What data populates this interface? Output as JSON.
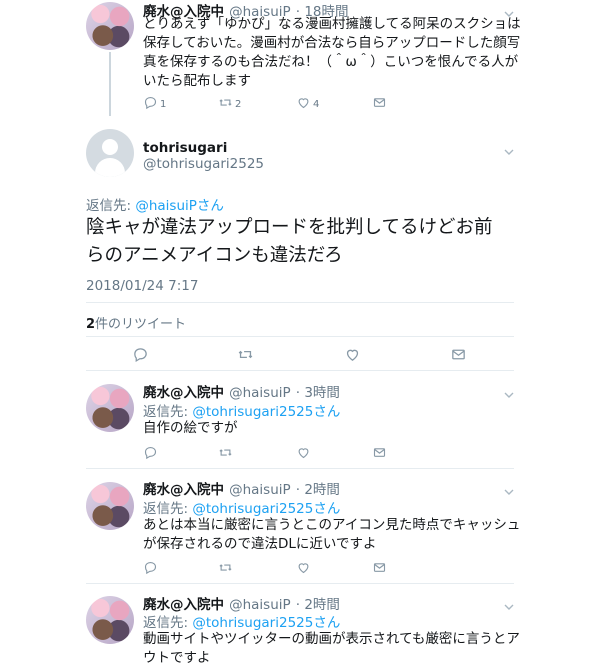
{
  "tweet1": {
    "name": "廃水@入院中",
    "handle": "@haisuiP",
    "time": "· 18時間",
    "text_lines": [
      "とりあえず「ゆかぴ」なる漫画村擁護してる阿呆のスクショは",
      "保存しておいた。漫画村が合法なら自らアップロードした顔写",
      "真を保存するのも合法だね！（＾ω＾）こいつを恨んでる人が",
      "いたら配布します"
    ],
    "reply_count": "1",
    "retweet_count": "2",
    "like_count": "4"
  },
  "main": {
    "name": "tohrisugari",
    "handle": "@tohrisugari2525",
    "reply_to_prefix": "返信先: ",
    "reply_to_handle": "@haisuiPさん",
    "text_lines": [
      "陰キャが違法アップロードを批判してるけどお前",
      "らのアニメアイコンも違法だろ"
    ],
    "timestamp": "2018/01/24 7:17",
    "retweet_num": "2",
    "retweet_label": "件のリツイート"
  },
  "replies": [
    {
      "name": "廃水@入院中",
      "handle": "@haisuiP",
      "time": "· 3時間",
      "reply_to_prefix": "返信先: ",
      "reply_to_handle": "@tohrisugari2525さん",
      "text_lines": [
        "自作の絵ですが"
      ]
    },
    {
      "name": "廃水@入院中",
      "handle": "@haisuiP",
      "time": "· 2時間",
      "reply_to_prefix": "返信先: ",
      "reply_to_handle": "@tohrisugari2525さん",
      "text_lines": [
        "あとは本当に厳密に言うとこのアイコン見た時点でキャッシュ",
        "が保存されるので違法DLに近いですよ"
      ]
    },
    {
      "name": "廃水@入院中",
      "handle": "@haisuiP",
      "time": "· 2時間",
      "reply_to_prefix": "返信先: ",
      "reply_to_handle": "@tohrisugari2525さん",
      "text_lines": [
        "動画サイトやツイッターの動画が表示されても厳密に言うとア",
        "ウトですよ"
      ]
    }
  ],
  "icons": {
    "reply": "reply-icon",
    "retweet": "retweet-icon",
    "like": "heart-icon",
    "dm": "mail-icon",
    "more": "chevron-down-icon",
    "avatar_default": "default-avatar-icon"
  },
  "colors": {
    "accent": "#1da1f2",
    "muted": "#657786",
    "text": "#14171a",
    "divider": "#e6ecf0"
  }
}
